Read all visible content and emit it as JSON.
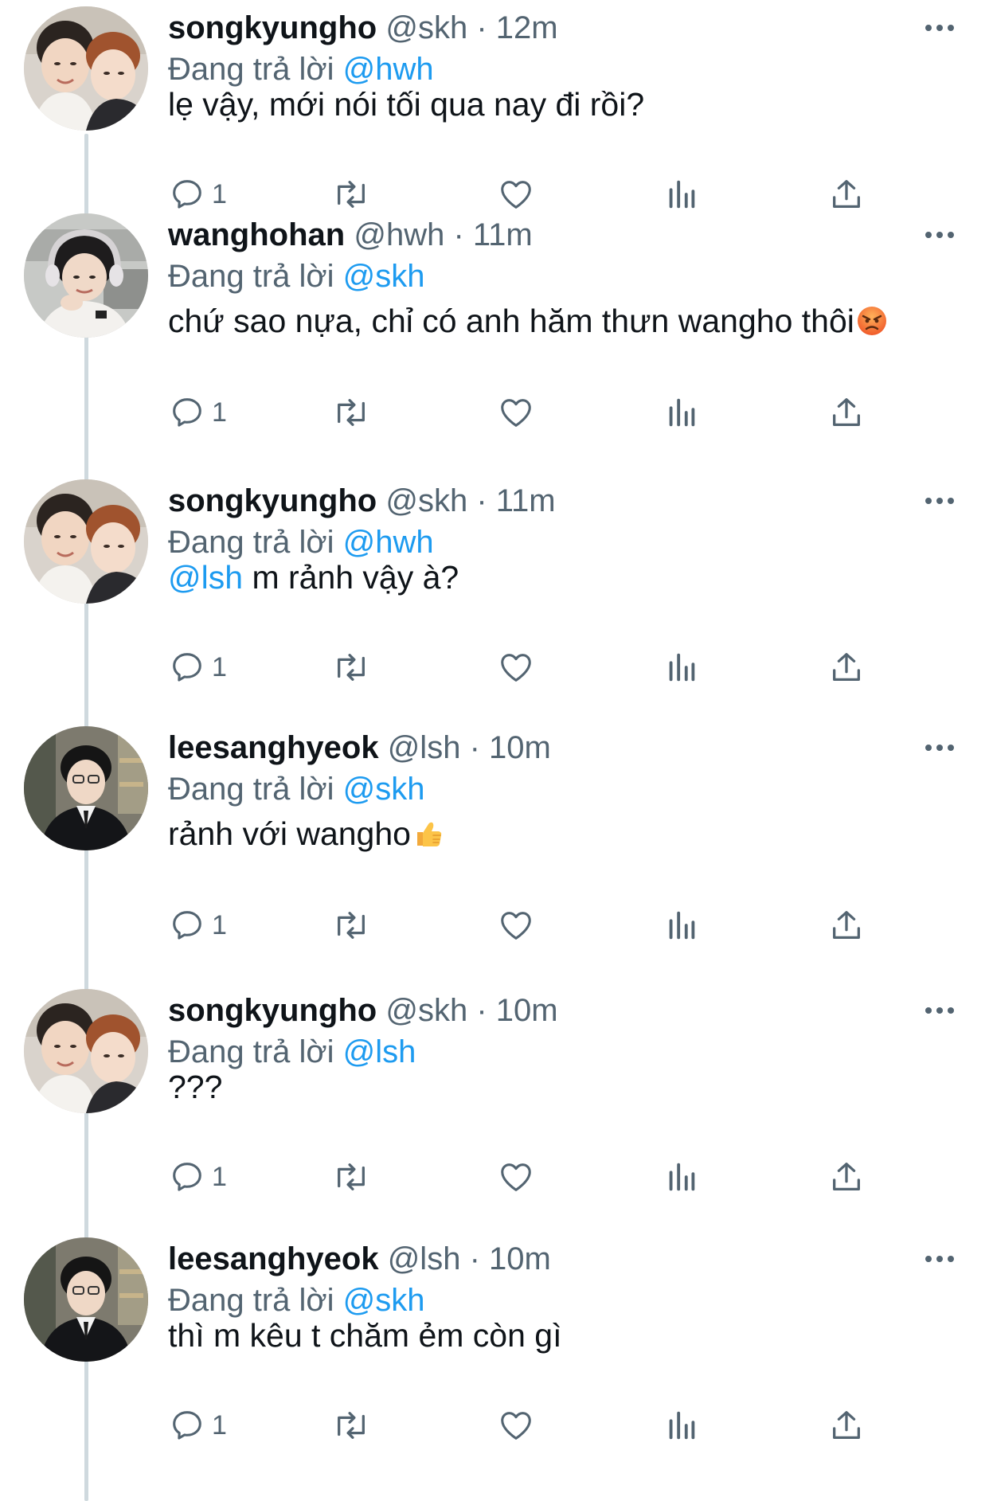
{
  "reply_prefix": "Đang trả lời",
  "colors": {
    "link": "#1d9bf0",
    "secondary_text": "#536471",
    "primary_text": "#0f1419",
    "icon": "#536471",
    "thread_line": "#cfd9de"
  },
  "icons": {
    "reply": "speech-bubble-icon",
    "retweet": "retweet-arrows-icon",
    "like": "heart-icon",
    "views": "bar-chart-icon",
    "share": "upload-arrow-icon",
    "more": "horizontal-ellipsis-icon"
  },
  "tweets": [
    {
      "name": "songkyungho",
      "handle": "@skh",
      "time": "12m",
      "reply_to": "@hwh",
      "text": "lẹ vậy, mới nói tối qua nay đi rồi?",
      "reply_count": "1"
    },
    {
      "name": "wanghohan",
      "handle": "@hwh",
      "time": "11m",
      "reply_to": "@skh",
      "text": "chứ sao nựa, chỉ có anh hăm thưn wangho thôi",
      "emoji": "angry-face-emoji",
      "reply_count": "1"
    },
    {
      "name": "songkyungho",
      "handle": "@skh",
      "time": "11m",
      "reply_to": "@hwh",
      "mention": "@lsh",
      "text": " m rảnh vậy à?",
      "reply_count": "1"
    },
    {
      "name": "leesanghyeok",
      "handle": "@lsh",
      "time": "10m",
      "reply_to": "@skh",
      "text": "rảnh với wangho",
      "emoji": "thumbs-up-emoji",
      "reply_count": "1"
    },
    {
      "name": "songkyungho",
      "handle": "@skh",
      "time": "10m",
      "reply_to": "@lsh",
      "text": "???",
      "reply_count": "1"
    },
    {
      "name": "leesanghyeok",
      "handle": "@lsh",
      "time": "10m",
      "reply_to": "@skh",
      "text": "thì m kêu t chăm ẻm còn gì",
      "reply_count": "1"
    }
  ]
}
